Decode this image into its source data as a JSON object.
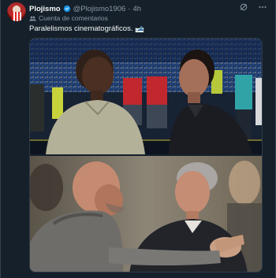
{
  "post": {
    "author_name": "Plojismo",
    "handle": "@Plojismo1906",
    "separator": "·",
    "time": "4h",
    "community": "Cuenta de comentarios",
    "text": "Paralelismos cinematográficos. 🎿"
  },
  "icons": {
    "verified": "verified-badge-icon",
    "grok": "grok-icon",
    "more": "more-options-icon",
    "community": "community-icon"
  },
  "colors": {
    "background": "#15202b",
    "text_primary": "#f7f9f9",
    "text_secondary": "#8b98a5",
    "verified_blue": "#1d9bf0"
  }
}
